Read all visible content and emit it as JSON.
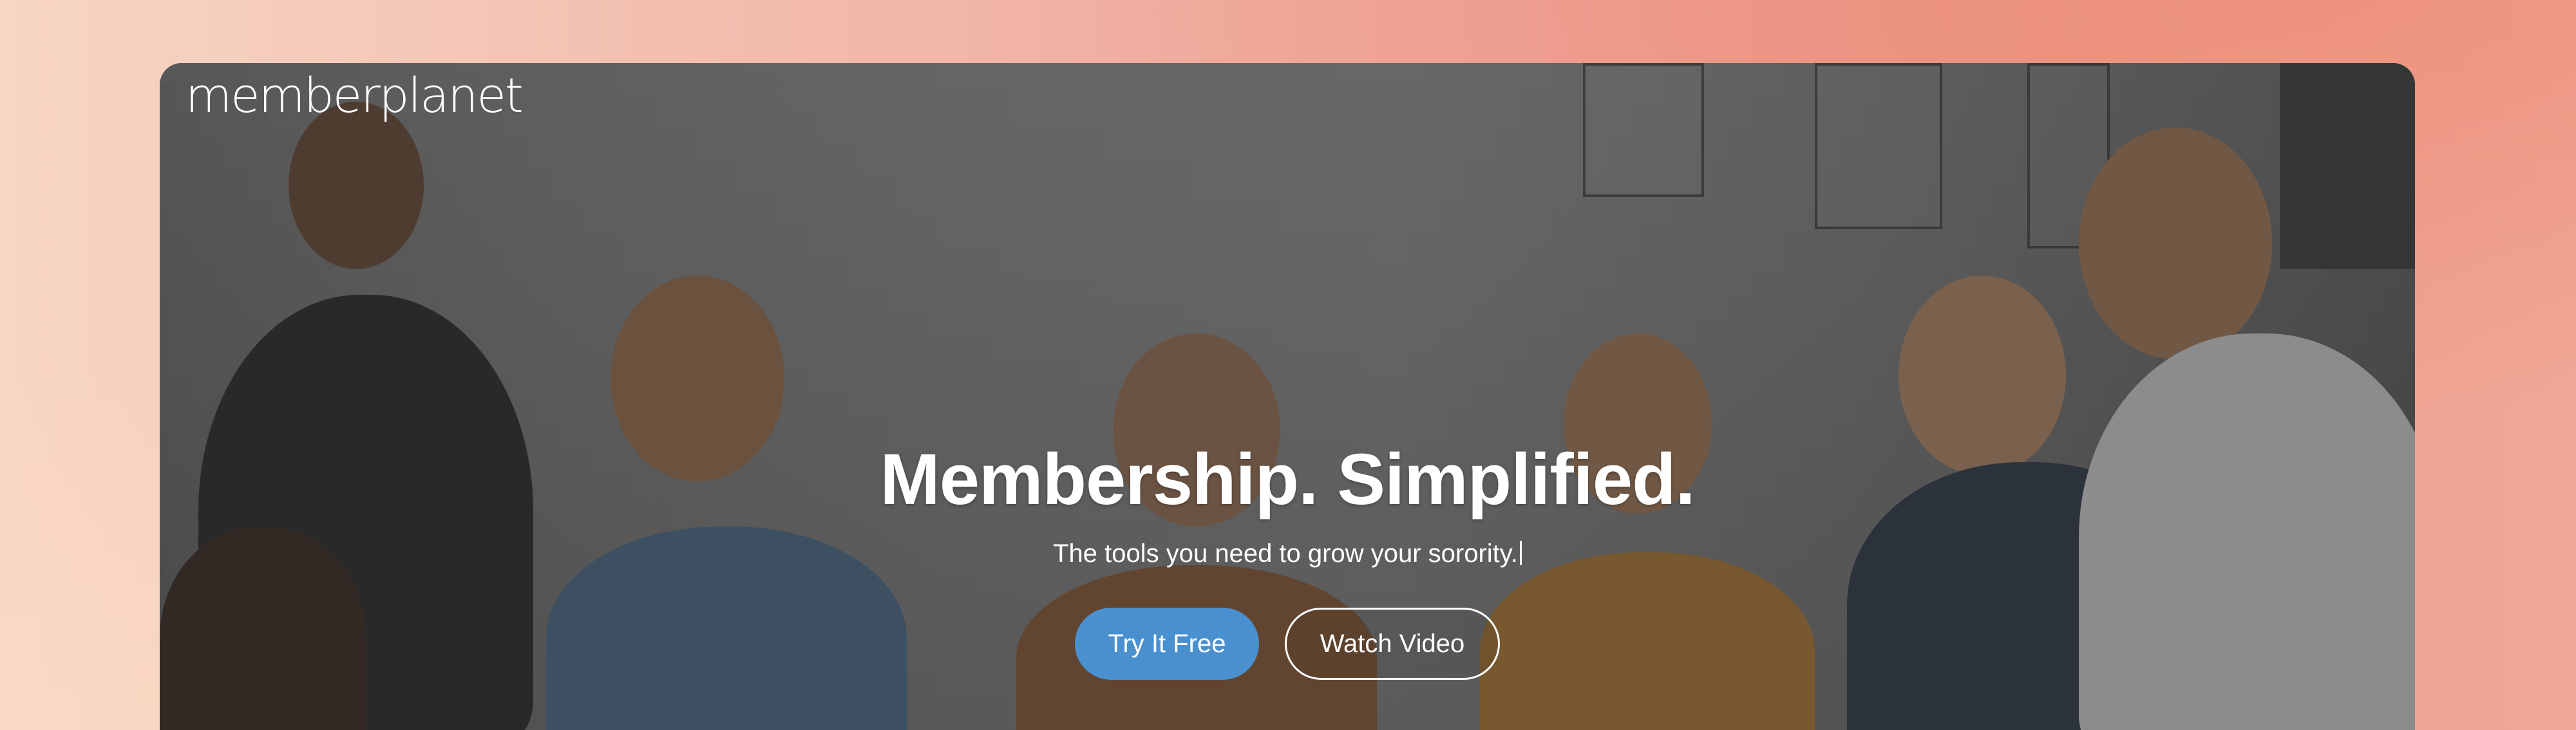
{
  "brand": {
    "logo_text": "memberplanet"
  },
  "hero": {
    "headline": "Membership. Simplified.",
    "subtitle": "The tools you need to grow your sorority."
  },
  "actions": {
    "primary_label": "Try It Free",
    "secondary_label": "Watch Video"
  },
  "colors": {
    "primary_button": "#4a90cf",
    "text": "#ffffff",
    "page_gradient_start": "#f7d6c4",
    "page_gradient_end": "#ec9a8a"
  }
}
